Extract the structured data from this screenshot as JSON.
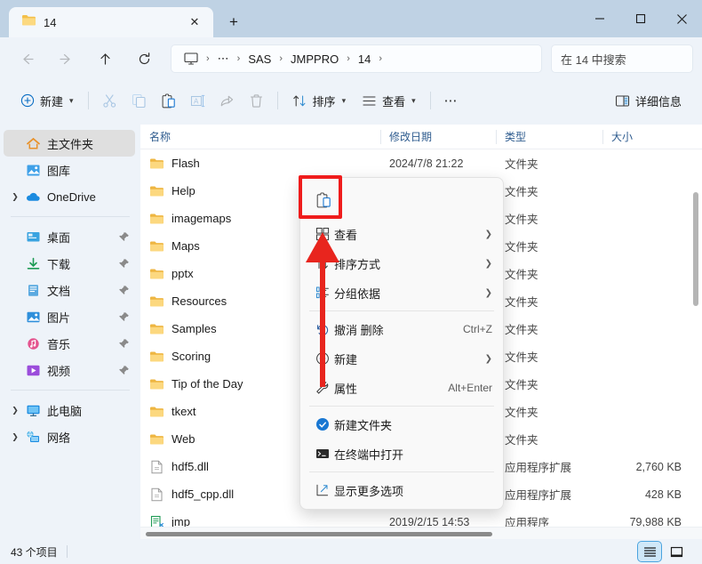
{
  "window": {
    "tab_title": "14",
    "tab_close_label": "✕",
    "new_tab_label": "+",
    "minimize_label": "─",
    "maximize_label": "☐",
    "close_label": "✕"
  },
  "nav": {
    "back_icon": "back-arrow-icon",
    "forward_icon": "forward-arrow-icon",
    "up_icon": "up-arrow-icon",
    "refresh_icon": "refresh-icon",
    "breadcrumbs": [
      "SAS",
      "JMPPRO",
      "14"
    ],
    "separator": "›",
    "overflow": "⋯",
    "search_placeholder": "在 14 中搜索"
  },
  "toolbar": {
    "new_label": "新建",
    "new_chevron": "⌵",
    "cut_label": "剪切",
    "copy_label": "复制",
    "paste_label": "粘贴",
    "rename_label": "重命名",
    "share_label": "共享",
    "delete_label": "删除",
    "sort_label": "排序",
    "view_label": "查看",
    "more_label": "⋯",
    "details_label": "详细信息"
  },
  "sidebar": {
    "items": [
      {
        "label": "主文件夹",
        "icon": "home-icon",
        "selected": true,
        "expandable": false,
        "pinned": false
      },
      {
        "label": "图库",
        "icon": "gallery-icon",
        "selected": false,
        "expandable": false,
        "pinned": false
      },
      {
        "label": "OneDrive",
        "icon": "onedrive-cloud-icon",
        "selected": false,
        "expandable": true,
        "pinned": false
      },
      {
        "label": "桌面",
        "icon": "desktop-icon",
        "selected": false,
        "expandable": false,
        "pinned": true
      },
      {
        "label": "下载",
        "icon": "downloads-icon",
        "selected": false,
        "expandable": false,
        "pinned": true
      },
      {
        "label": "文档",
        "icon": "documents-icon",
        "selected": false,
        "expandable": false,
        "pinned": true
      },
      {
        "label": "图片",
        "icon": "pictures-icon",
        "selected": false,
        "expandable": false,
        "pinned": true
      },
      {
        "label": "音乐",
        "icon": "music-icon",
        "selected": false,
        "expandable": false,
        "pinned": true
      },
      {
        "label": "视频",
        "icon": "videos-icon",
        "selected": false,
        "expandable": false,
        "pinned": true
      },
      {
        "label": "此电脑",
        "icon": "this-pc-icon",
        "selected": false,
        "expandable": true,
        "pinned": false
      },
      {
        "label": "网络",
        "icon": "network-icon",
        "selected": false,
        "expandable": true,
        "pinned": false
      }
    ]
  },
  "filelist": {
    "columns": [
      "名称",
      "修改日期",
      "类型",
      "大小"
    ],
    "rows": [
      {
        "name": "Flash",
        "date": "2024/7/8 21:22",
        "type": "文件夹",
        "size": "",
        "icon": "folder-icon"
      },
      {
        "name": "Help",
        "date": "",
        "type": "文件夹",
        "size": "",
        "icon": "folder-icon"
      },
      {
        "name": "imagemaps",
        "date": "",
        "type": "文件夹",
        "size": "",
        "icon": "folder-icon"
      },
      {
        "name": "Maps",
        "date": "",
        "type": "文件夹",
        "size": "",
        "icon": "folder-icon"
      },
      {
        "name": "pptx",
        "date": "",
        "type": "文件夹",
        "size": "",
        "icon": "folder-icon"
      },
      {
        "name": "Resources",
        "date": "",
        "type": "文件夹",
        "size": "",
        "icon": "folder-icon"
      },
      {
        "name": "Samples",
        "date": "",
        "type": "文件夹",
        "size": "",
        "icon": "folder-icon"
      },
      {
        "name": "Scoring",
        "date": "",
        "type": "文件夹",
        "size": "",
        "icon": "folder-icon"
      },
      {
        "name": "Tip of the Day",
        "date": "",
        "type": "文件夹",
        "size": "",
        "icon": "folder-icon"
      },
      {
        "name": "tkext",
        "date": "",
        "type": "文件夹",
        "size": "",
        "icon": "folder-icon"
      },
      {
        "name": "Web",
        "date": "",
        "type": "文件夹",
        "size": "",
        "icon": "folder-icon"
      },
      {
        "name": "hdf5.dll",
        "date": "",
        "type": "应用程序扩展",
        "size": "2,760 KB",
        "icon": "dll-file-icon"
      },
      {
        "name": "hdf5_cpp.dll",
        "date": "",
        "type": "应用程序扩展",
        "size": "428 KB",
        "icon": "dll-file-icon"
      },
      {
        "name": "jmp",
        "date": "2019/2/15 14:53",
        "type": "应用程序",
        "size": "79,988 KB",
        "icon": "jmp-app-icon"
      }
    ]
  },
  "context_menu": {
    "icon_row": [
      {
        "name": "paste-icon",
        "label": "粘贴",
        "highlighted": true
      }
    ],
    "items": [
      {
        "label": "查看",
        "icon": "view-icon",
        "accel": "",
        "submenu": true
      },
      {
        "label": "排序方式",
        "icon": "sort-icon",
        "accel": "",
        "submenu": true
      },
      {
        "label": "分组依据",
        "icon": "group-icon",
        "accel": "",
        "submenu": true
      },
      {
        "divider": true
      },
      {
        "label": "撤消 删除",
        "icon": "undo-icon",
        "accel": "Ctrl+Z",
        "submenu": false
      },
      {
        "label": "新建",
        "icon": "new-plus-icon",
        "accel": "",
        "submenu": true
      },
      {
        "label": "属性",
        "icon": "properties-wrench-icon",
        "accel": "Alt+Enter",
        "submenu": false
      },
      {
        "divider": true
      },
      {
        "label": "新建文件夹",
        "icon": "new-folder-blue-icon",
        "accel": "",
        "submenu": false
      },
      {
        "label": "在终端中打开",
        "icon": "terminal-icon",
        "accel": "",
        "submenu": false
      },
      {
        "divider": true
      },
      {
        "label": "显示更多选项",
        "icon": "show-more-options-icon",
        "accel": "",
        "submenu": false
      }
    ]
  },
  "status": {
    "item_count": "43 个项目",
    "view_details_icon": "details-view-icon",
    "view_tiles_icon": "tiles-view-icon"
  },
  "colors": {
    "titlebar": "#bfd2e4",
    "chrome": "#eef3f9",
    "pane": "#ffffff",
    "accent": "#0078d4",
    "folder": "#f8c550",
    "highlight_red": "#ef1c1c",
    "column_header_text": "#2f5c8f"
  }
}
